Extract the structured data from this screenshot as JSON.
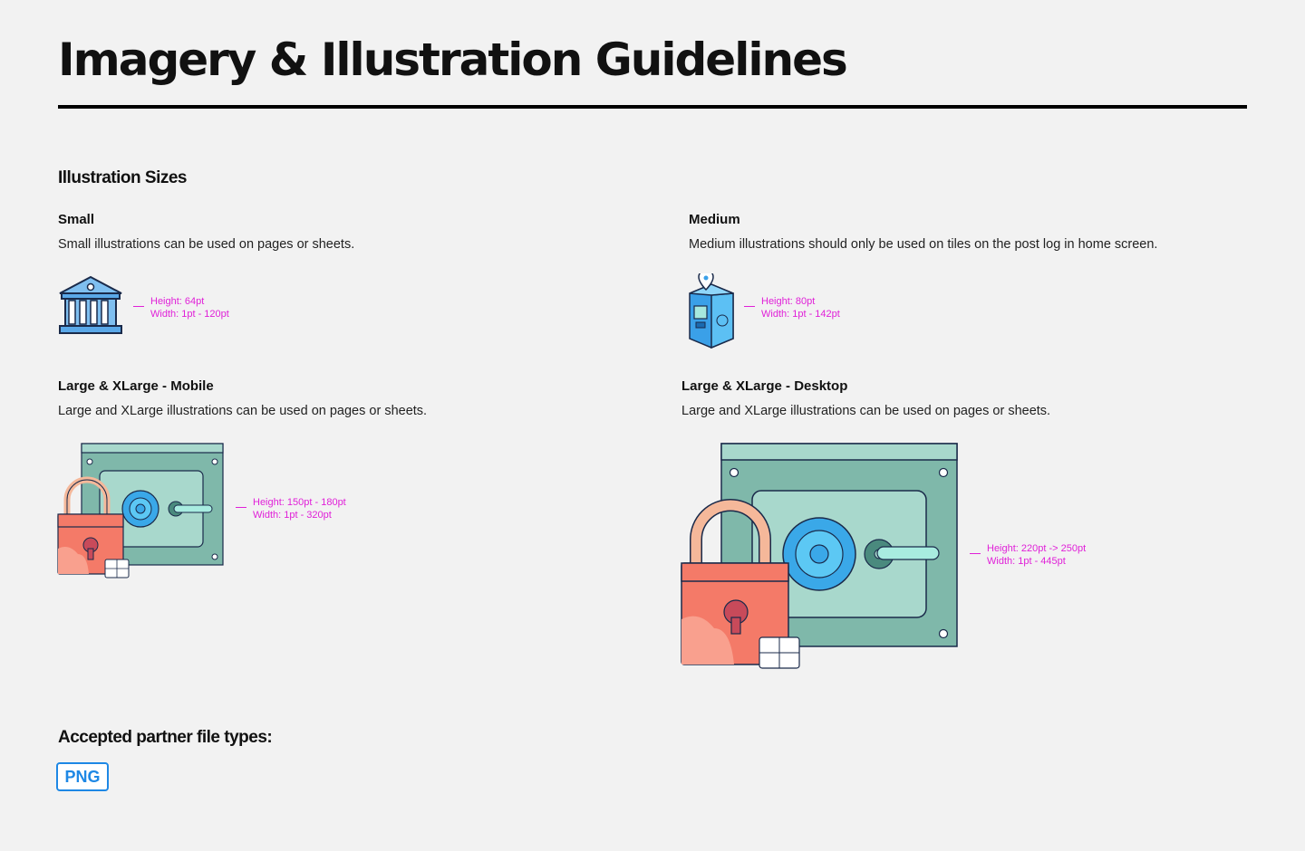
{
  "title": "Imagery & Illustration Guidelines",
  "sizes_heading": "Illustration Sizes",
  "small": {
    "title": "Small",
    "description": "Small illustrations can be used on pages or sheets.",
    "height_spec": "Height: 64pt",
    "width_spec": "Width: 1pt - 120pt",
    "icon": "bank-icon"
  },
  "medium": {
    "title": "Medium",
    "description": "Medium illustrations should only be used on tiles on the post log in home screen.",
    "height_spec": "Height: 80pt",
    "width_spec": "Width: 1pt - 142pt",
    "icon": "atm-location-icon"
  },
  "large_mobile": {
    "title": "Large & XLarge - Mobile",
    "description": "Large and XLarge illustrations can be used on pages or sheets.",
    "height_spec": "Height: 150pt - 180pt",
    "width_spec": "Width: 1pt - 320pt",
    "icon": "safe-lock-illustration"
  },
  "large_desktop": {
    "title": "Large & XLarge - Desktop",
    "description": "Large and XLarge illustrations can be used on pages or sheets.",
    "height_spec": "Height: 220pt -> 250pt",
    "width_spec": "Width: 1pt - 445pt",
    "icon": "safe-lock-illustration"
  },
  "accepted": {
    "heading": "Accepted partner file types:",
    "file_types": [
      "PNG"
    ]
  },
  "colors": {
    "spec_magenta": "#e020d8",
    "badge_blue": "#1e88e5",
    "safe_teal": "#a8d8cc",
    "lock_coral": "#f47a68"
  }
}
